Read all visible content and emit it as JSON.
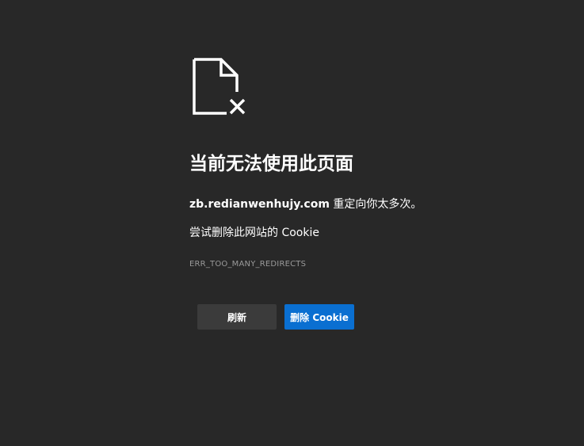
{
  "page": {
    "icon": "broken-document-icon",
    "title": "当前无法使用此页面",
    "message_host": "zb.redianwenhujy.com",
    "message_rest": " 重定向你太多次。",
    "suggestion": "尝试删除此网站的 Cookie",
    "error_code": "ERR_TOO_MANY_REDIRECTS"
  },
  "buttons": {
    "refresh_label": "刷新",
    "delete_cookie_label": "删除 Cookie"
  },
  "colors": {
    "background": "#282828",
    "secondary_button": "#3b3b3b",
    "primary_button": "#0a6fd1",
    "error_code_text": "#9a9a9a"
  }
}
